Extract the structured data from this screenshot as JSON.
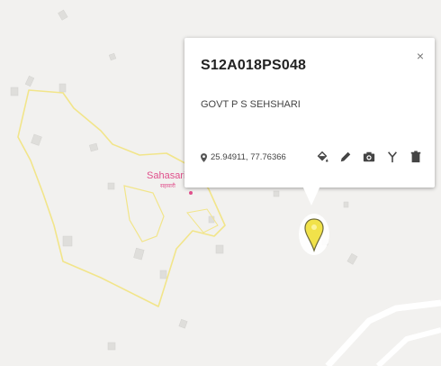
{
  "map": {
    "village_label": "Sahasari",
    "village_label_local": "सहसारी",
    "boundary_color": "#f2e58a",
    "village_label_color": "#e0508c"
  },
  "popup": {
    "title": "S12A018PS048",
    "subtitle": "GOVT P S SEHSHARI",
    "close_label": "×",
    "coordinates": "25.94911, 77.76366",
    "actions": [
      "paint-bucket-icon",
      "pencil-icon",
      "camera-icon",
      "fork-icon",
      "trash-icon"
    ]
  },
  "marker": {
    "color": "#f1e24a"
  }
}
